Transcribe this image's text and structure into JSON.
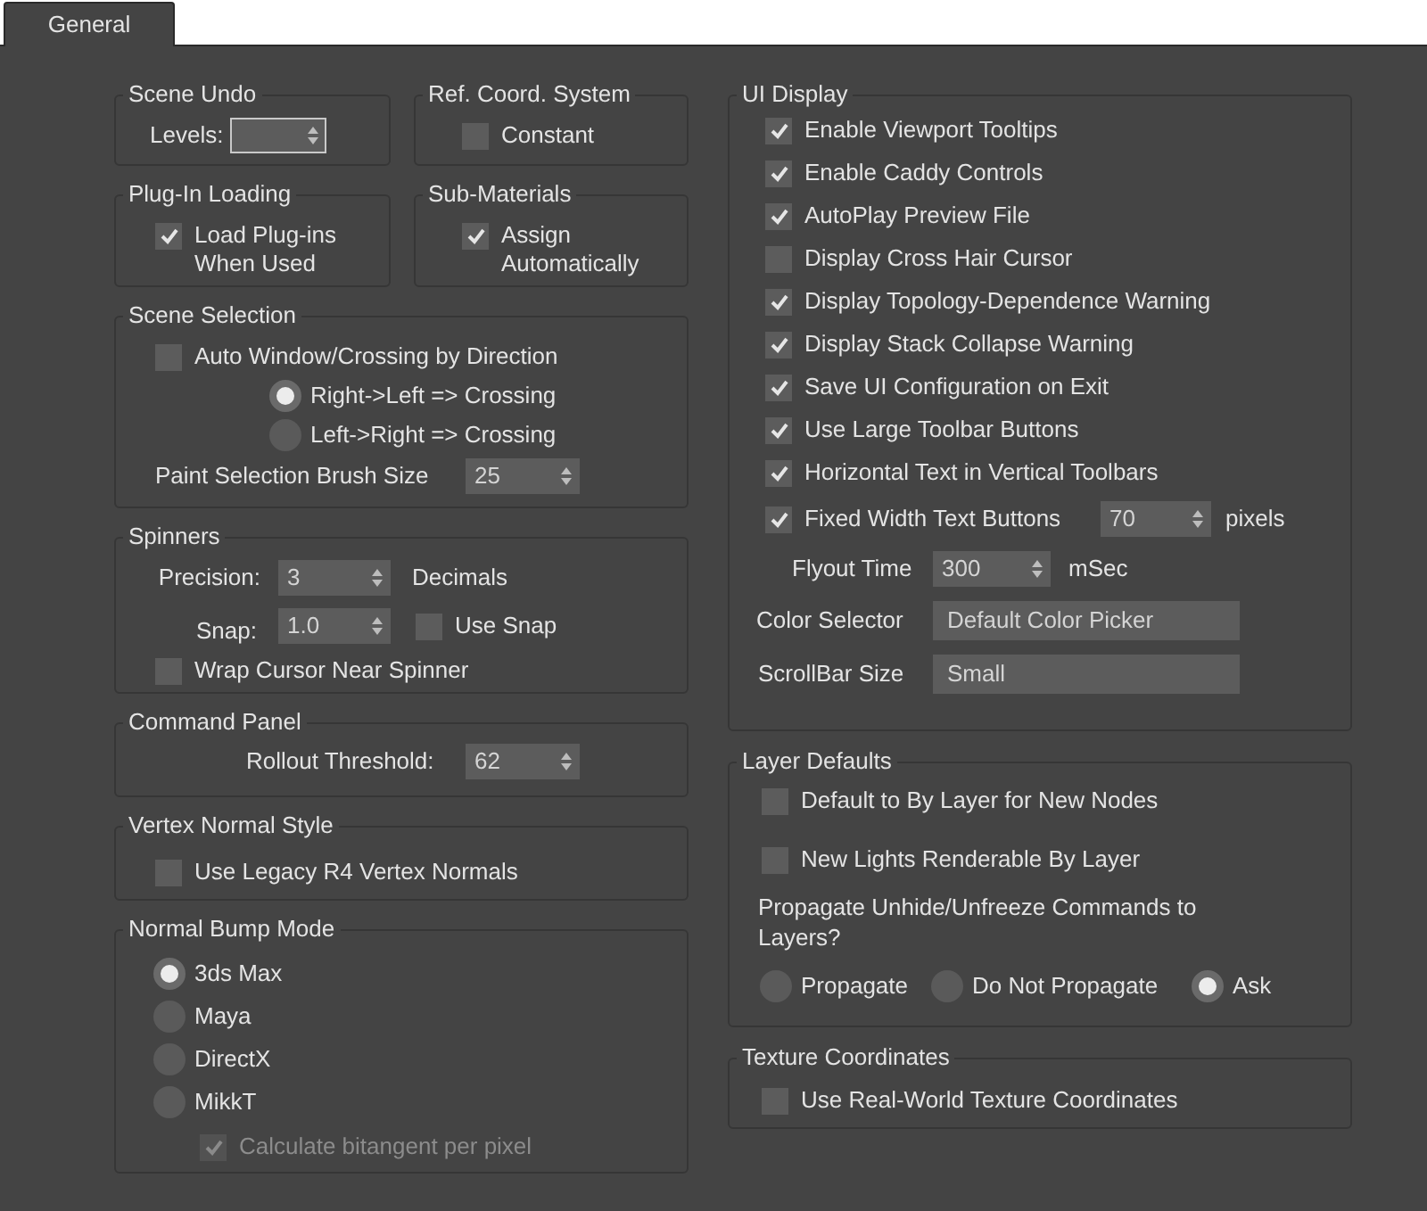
{
  "tabs": [
    {
      "label": "General",
      "selected": true
    }
  ],
  "scene_undo": {
    "title": "Scene Undo",
    "levels": {
      "label": "Levels:",
      "focused": true
    }
  },
  "ref_coord_system": {
    "title": "Ref. Coord. System",
    "constant": {
      "label": "Constant",
      "checked": false
    }
  },
  "plugin_loading": {
    "title": "Plug-In Loading",
    "load_when_used": {
      "label": "Load Plug-ins When Used",
      "checked": true
    }
  },
  "sub_materials": {
    "title": "Sub-Materials",
    "assign_automatically": {
      "label": "Assign Automatically",
      "checked": true
    }
  },
  "scene_selection": {
    "title": "Scene Selection",
    "auto_window": {
      "label": "Auto Window/Crossing by Direction",
      "checked": false
    },
    "direction": [
      {
        "label": "Right->Left => Crossing",
        "selected": true
      },
      {
        "label": "Left->Right => Crossing",
        "selected": false
      }
    ],
    "brush_size": {
      "label": "Paint Selection Brush Size",
      "value": "25"
    }
  },
  "spinners": {
    "title": "Spinners",
    "precision": {
      "label": "Precision:",
      "value": "3",
      "unit": "Decimals"
    },
    "snap": {
      "label": "Snap:",
      "value": "1.0"
    },
    "use_snap": {
      "label": "Use Snap",
      "checked": false
    },
    "wrap_cursor": {
      "label": "Wrap Cursor Near Spinner",
      "checked": false
    }
  },
  "command_panel": {
    "title": "Command Panel",
    "rollout_threshold": {
      "label": "Rollout Threshold:",
      "value": "62"
    }
  },
  "vertex_normal_style": {
    "title": "Vertex Normal Style",
    "legacy": {
      "label": "Use Legacy R4 Vertex Normals",
      "checked": false
    }
  },
  "normal_bump_mode": {
    "title": "Normal Bump Mode",
    "modes": [
      {
        "label": "3ds Max",
        "selected": true
      },
      {
        "label": "Maya",
        "selected": false
      },
      {
        "label": "DirectX",
        "selected": false
      },
      {
        "label": "MikkT",
        "selected": false
      }
    ],
    "bitangent": {
      "label": "Calculate bitangent per pixel",
      "checked": true,
      "disabled": true
    }
  },
  "ui_display": {
    "title": "UI Display",
    "options": [
      {
        "label": "Enable Viewport Tooltips",
        "checked": true
      },
      {
        "label": "Enable Caddy Controls",
        "checked": true
      },
      {
        "label": "AutoPlay Preview File",
        "checked": true
      },
      {
        "label": "Display Cross Hair Cursor",
        "checked": false
      },
      {
        "label": "Display Topology-Dependence Warning",
        "checked": true
      },
      {
        "label": "Display Stack Collapse Warning",
        "checked": true
      },
      {
        "label": "Save UI Configuration on Exit",
        "checked": true
      },
      {
        "label": "Use Large Toolbar Buttons",
        "checked": true
      },
      {
        "label": "Horizontal Text in Vertical Toolbars",
        "checked": true
      }
    ],
    "fixed_width": {
      "label": "Fixed Width Text Buttons",
      "checked": true,
      "value": "70",
      "unit": "pixels"
    },
    "flyout_time": {
      "label": "Flyout Time",
      "value": "300",
      "unit": "mSec"
    },
    "color_selector": {
      "label": "Color Selector",
      "value": "Default Color Picker"
    },
    "scrollbar_size": {
      "label": "ScrollBar Size",
      "value": "Small"
    }
  },
  "layer_defaults": {
    "title": "Layer Defaults",
    "options": [
      {
        "label": "Default to By Layer for New Nodes",
        "checked": false
      },
      {
        "label": "New Lights Renderable By Layer",
        "checked": false
      }
    ],
    "propagate_question": "Propagate Unhide/Unfreeze Commands to Layers?",
    "propagate_modes": [
      {
        "label": "Propagate",
        "selected": false
      },
      {
        "label": "Do Not Propagate",
        "selected": false
      },
      {
        "label": "Ask",
        "selected": true
      }
    ]
  },
  "texture_coordinates": {
    "title": "Texture Coordinates",
    "real_world": {
      "label": "Use Real-World Texture Coordinates",
      "checked": false
    }
  }
}
